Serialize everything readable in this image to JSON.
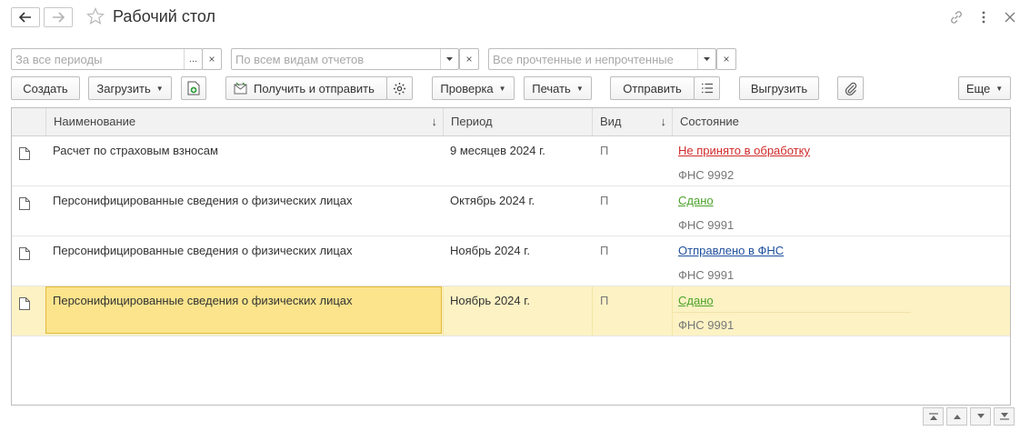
{
  "window": {
    "title": "Рабочий стол",
    "back_icon": "arrow-left-icon",
    "forward_icon": "arrow-right-icon",
    "favorite_icon": "star-icon",
    "link_icon": "link-icon",
    "more_icon": "more-vertical-icon",
    "close_icon": "close-icon"
  },
  "filters": {
    "period": {
      "placeholder": "За все периоды",
      "button": "...",
      "clear": "×"
    },
    "report_type": {
      "placeholder": "По всем видам отчетов",
      "clear": "×"
    },
    "read_state": {
      "placeholder": "Все прочтенные и непрочтенные",
      "clear": "×"
    }
  },
  "toolbar": {
    "create": "Создать",
    "load": "Загрузить",
    "receive_send": "Получить и отправить",
    "check": "Проверка",
    "print": "Печать",
    "send": "Отправить",
    "export": "Выгрузить",
    "more": "Еще"
  },
  "table": {
    "columns": {
      "name": "Наименование",
      "period": "Период",
      "kind": "Вид",
      "state": "Состояние"
    },
    "sort_arrow": "↓",
    "rows": [
      {
        "name": "Расчет по страховым взносам",
        "period": "9 месяцев 2024 г.",
        "kind": "П",
        "state": "Не принято в обработку",
        "state_color": "#d02b2b",
        "authority": "ФНС 9992"
      },
      {
        "name": "Персонифицированные сведения о физических лицах",
        "period": "Октябрь 2024 г.",
        "kind": "П",
        "state": "Сдано",
        "state_color": "#4ca12a",
        "authority": "ФНС 9991"
      },
      {
        "name": "Персонифицированные сведения о физических лицах",
        "period": "Ноябрь 2024 г.",
        "kind": "П",
        "state": "Отправлено в ФНС",
        "state_color": "#1f4f9c",
        "authority": "ФНС 9991"
      },
      {
        "name": "Персонифицированные сведения о физических лицах",
        "period": "Ноябрь 2024 г.",
        "kind": "П",
        "state": "Сдано",
        "state_color": "#4ca12a",
        "authority": "ФНС 9991",
        "selected": true
      }
    ]
  },
  "colors": {
    "selection": "#fcf2c4",
    "selected_cell": "#fbe48c",
    "selected_border": "#e2b93b"
  }
}
